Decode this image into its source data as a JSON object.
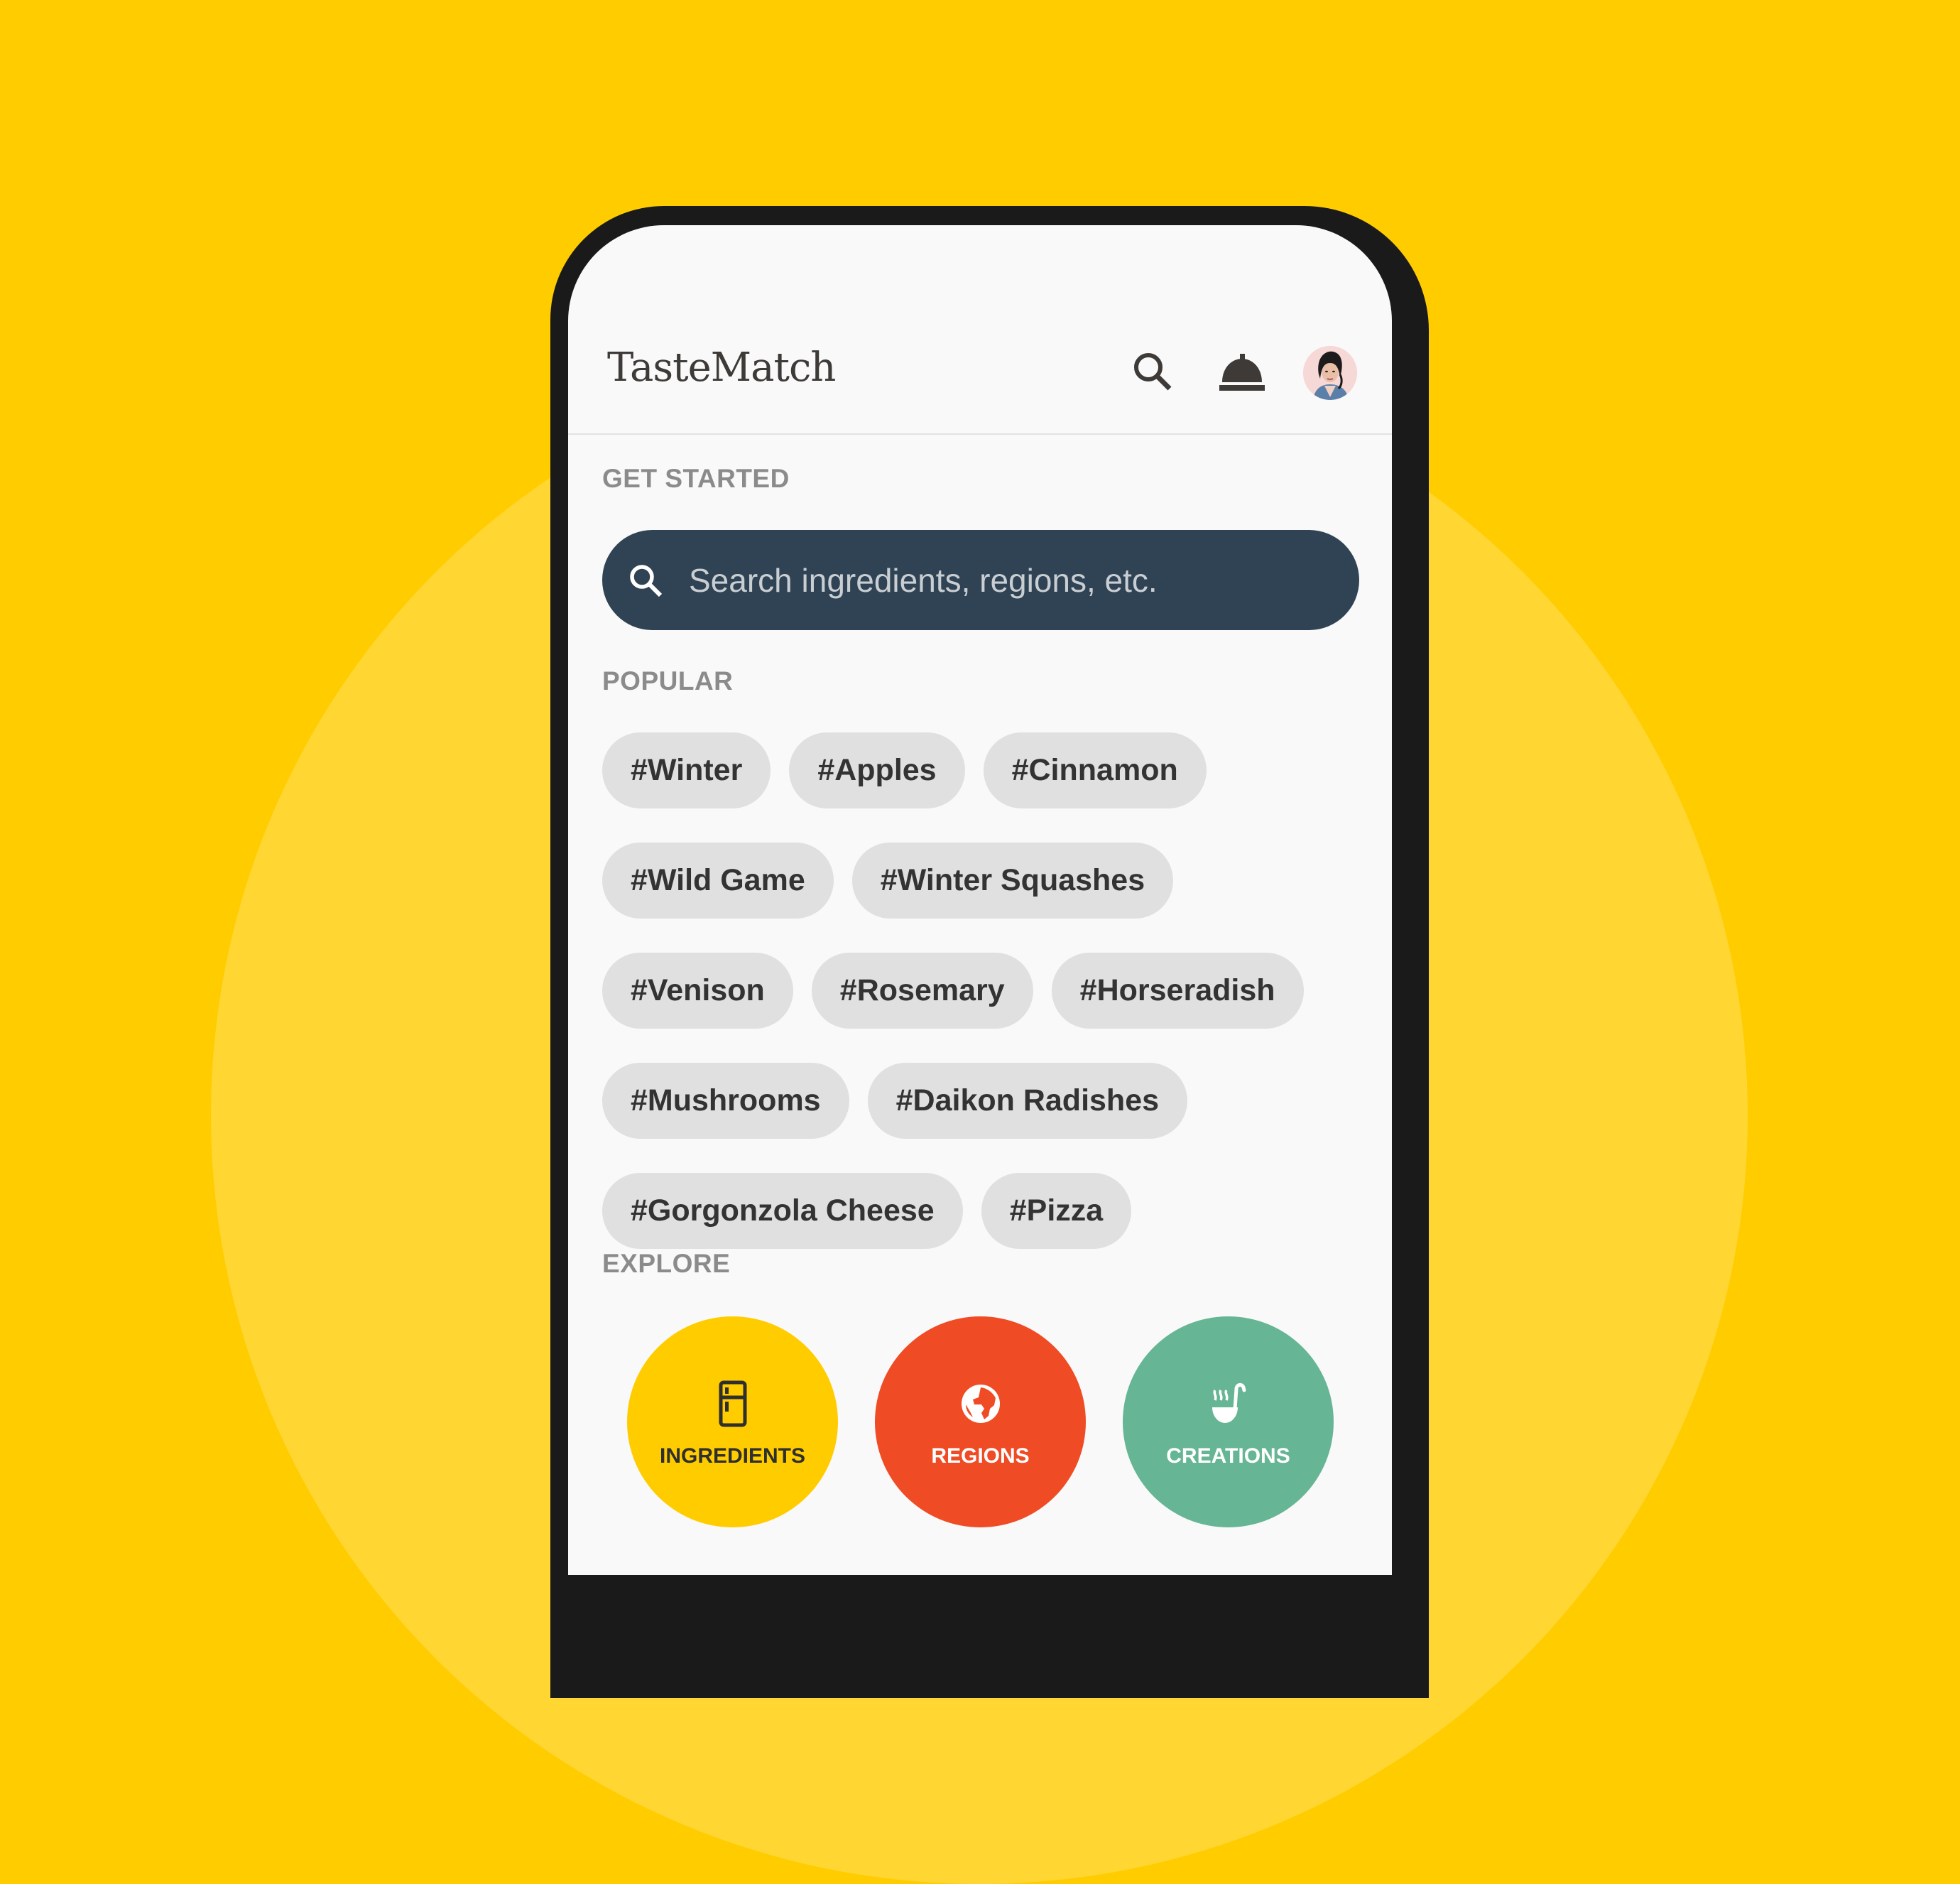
{
  "colors": {
    "background": "#FFCC00",
    "background_circle": "#FFD632",
    "phone_frame": "#1a1a1a",
    "screen": "#f9f9f9",
    "search_bar": "#2f4354",
    "chip": "#e0e0e0",
    "ingredients": "#FFCC00",
    "regions": "#EF4B25",
    "creations": "#66B595"
  },
  "header": {
    "title": "TasteMatch",
    "icons": [
      "search-icon",
      "room-service-bell-icon"
    ],
    "avatar": "user-avatar"
  },
  "sections": {
    "get_started": "GET STARTED",
    "popular": "POPULAR",
    "explore": "EXPLORE"
  },
  "search": {
    "placeholder": "Search ingredients, regions, etc.",
    "value": "",
    "icon": "search-icon"
  },
  "popular_tags": [
    "#Winter",
    "#Apples",
    "#Cinnamon",
    "#Wild Game",
    "#Winter Squashes",
    "#Venison",
    "#Rosemary",
    "#Horseradish",
    "#Mushrooms",
    "#Daikon Radishes",
    "#Gorgonzola Cheese",
    "#Pizza"
  ],
  "explore": [
    {
      "label": "INGREDIENTS",
      "icon": "fridge-icon",
      "color": "#FFCC00",
      "text_color": "#2f2f2f"
    },
    {
      "label": "REGIONS",
      "icon": "globe-icon",
      "color": "#EF4B25",
      "text_color": "#ffffff"
    },
    {
      "label": "CREATIONS",
      "icon": "soup-ladle-icon",
      "color": "#66B595",
      "text_color": "#ffffff"
    }
  ]
}
